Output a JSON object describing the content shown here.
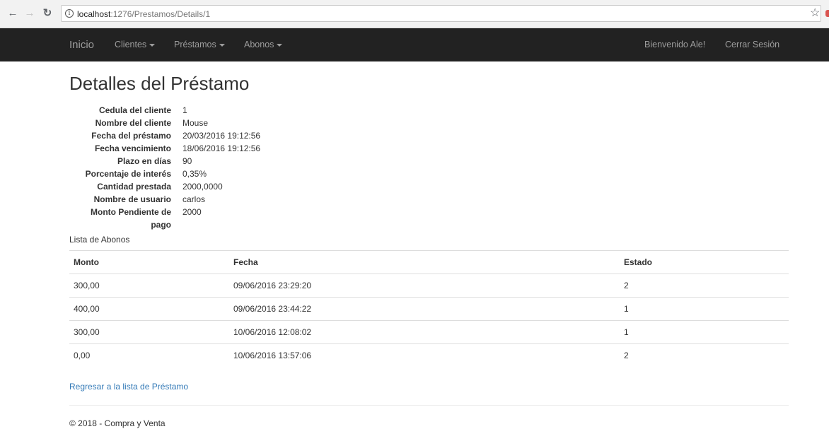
{
  "browser": {
    "url_host": "localhost",
    "url_path": ":1276/Prestamos/Details/1"
  },
  "navbar": {
    "brand": "Inicio",
    "menus": [
      "Clientes",
      "Préstamos",
      "Abonos"
    ],
    "welcome": "Bienvenido Ale!",
    "logout": "Cerrar Sesión"
  },
  "page": {
    "title": "Detalles del Préstamo"
  },
  "details": [
    {
      "label": "Cedula del cliente",
      "value": "1"
    },
    {
      "label": "Nombre del cliente",
      "value": "Mouse"
    },
    {
      "label": "Fecha del préstamo",
      "value": "20/03/2016 19:12:56"
    },
    {
      "label": "Fecha vencimiento",
      "value": "18/06/2016 19:12:56"
    },
    {
      "label": "Plazo en días",
      "value": "90"
    },
    {
      "label": "Porcentaje de interés",
      "value": "0,35%"
    },
    {
      "label": "Cantidad prestada",
      "value": "2000,0000"
    },
    {
      "label": "Nombre de usuario",
      "value": "carlos"
    },
    {
      "label_line1": "Monto Pendiente de",
      "label_line2": "pago",
      "value": "2000"
    }
  ],
  "abonos": {
    "caption": "Lista de Abonos",
    "headers": [
      "Monto",
      "Fecha",
      "Estado"
    ],
    "rows": [
      [
        "300,00",
        "09/06/2016 23:29:20",
        "2"
      ],
      [
        "400,00",
        "09/06/2016 23:44:22",
        "1"
      ],
      [
        "300,00",
        "10/06/2016 12:08:02",
        "1"
      ],
      [
        "0,00",
        "10/06/2016 13:57:06",
        "2"
      ]
    ]
  },
  "back_link": "Regresar a la lista de Préstamo",
  "footer": "© 2018 - Compra y Venta",
  "colors": {
    "navbar_bg": "#222222",
    "navbar_text": "#9d9d9d",
    "link": "#337ab7"
  }
}
